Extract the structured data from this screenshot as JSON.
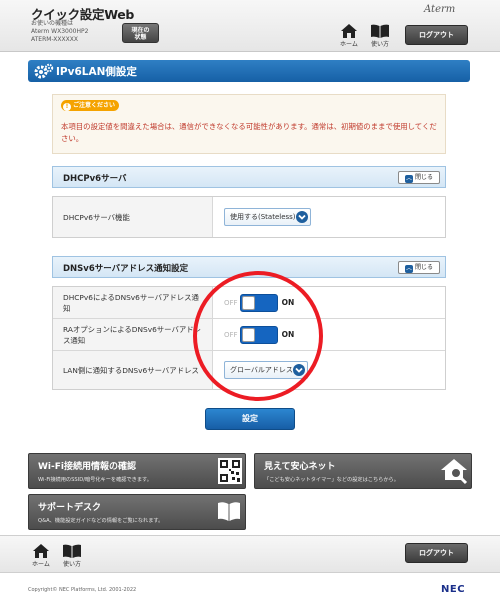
{
  "header": {
    "app_title": "クイック設定Web",
    "device_label": "お使いの機種は",
    "device_model": "Aterm WX3000HP2",
    "device_id": "ATERM-XXXXXX",
    "status_btn_line1": "現在の",
    "status_btn_line2": "状態",
    "brand": "Aterm",
    "home_label": "ホーム",
    "help_label": "使い方",
    "logout_label": "ログアウト"
  },
  "page": {
    "title": "IPv6LAN側設定"
  },
  "caution": {
    "badge": "ご注意ください",
    "text": "本項目の設定値を間違えた場合は、通信ができなくなる可能性があります。通常は、初期値のままで使用してください。"
  },
  "sections": {
    "dhcpv6": {
      "title": "DHCPv6サーバ",
      "close_label": "閉じる",
      "rows": [
        {
          "label": "DHCPv6サーバ機能",
          "value": "使用する(Stateless)"
        }
      ]
    },
    "dns": {
      "title": "DNSv6サーバアドレス通知設定",
      "close_label": "閉じる",
      "rows": [
        {
          "label": "DHCPv6によるDNSv6サーバアドレス通知",
          "off": "OFF",
          "on": "ON"
        },
        {
          "label": "RAオプションによるDNSv6サーバアドレス通知",
          "off": "OFF",
          "on": "ON"
        },
        {
          "label": "LAN側に通知するDNSv6サーバアドレス",
          "value": "グローバルアドレス"
        }
      ]
    }
  },
  "actions": {
    "submit_label": "設定"
  },
  "cards": [
    {
      "title": "Wi-Fi接続用情報の確認",
      "subtitle": "Wi-Fi接続用のSSID/暗号化キーを確認できます。"
    },
    {
      "title": "見えて安心ネット",
      "subtitle": "「こども安心ネットタイマー」などの設定はこちらから。"
    },
    {
      "title": "サポートデスク",
      "subtitle": "Q&A、機能設定ガイドなどの情報をご覧になれます。"
    }
  ],
  "footer": {
    "home_label": "ホーム",
    "help_label": "使い方",
    "logout_label": "ログアウト",
    "copyright": "Copyright© NEC Platforms, Ltd. 2001-2022",
    "logo": "NEC"
  },
  "colors": {
    "accent": "#1660a6",
    "toggle_on": "#1565c0",
    "caution": "#f5a300",
    "highlight_ring": "#ec1c24"
  },
  "icons": [
    "gear-icon",
    "home-icon",
    "book-icon",
    "qr-code-icon",
    "house-search-icon",
    "chevron-down-icon",
    "chevron-up-icon"
  ]
}
